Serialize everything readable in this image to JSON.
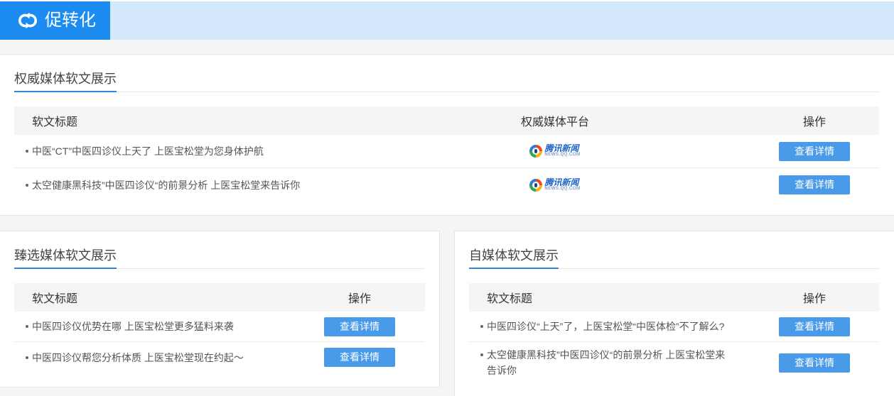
{
  "header": {
    "title": "促转化",
    "logo_icon": "cycle-arrows-icon"
  },
  "colors": {
    "brand_blue": "#1c8cf0",
    "header_bar": "#d4e8fc",
    "button_blue": "#4a9aea",
    "title_underline": "#2b87dc"
  },
  "authority_media": {
    "title": "权威媒体软文展示",
    "columns": {
      "title": "软文标题",
      "platform": "权威媒体平台",
      "action": "操作"
    },
    "rows": [
      {
        "title": "中医“CT”中医四诊仪上天了 上医宝松堂为您身体护航",
        "platform_icon": "tencent-news-icon",
        "platform_name": "腾讯新闻",
        "platform_domain": "NEWS.QQ.COM",
        "action": "查看详情"
      },
      {
        "title": "太空健康黑科技”中医四诊仪“的前景分析 上医宝松堂来告诉你",
        "platform_icon": "tencent-news-icon",
        "platform_name": "腾讯新闻",
        "platform_domain": "NEWS.QQ.COM",
        "action": "查看详情"
      }
    ]
  },
  "selected_media": {
    "title": "臻选媒体软文展示",
    "columns": {
      "title": "软文标题",
      "action": "操作"
    },
    "rows": [
      {
        "title": "中医四诊仪优势在哪 上医宝松堂更多猛料来袭",
        "action": "查看详情"
      },
      {
        "title": "中医四诊仪帮您分析体质 上医宝松堂现在约起～",
        "action": "查看详情"
      }
    ]
  },
  "self_media": {
    "title": "自媒体软文展示",
    "columns": {
      "title": "软文标题",
      "action": "操作"
    },
    "rows": [
      {
        "title": "中医四诊仪“上天”了，上医宝松堂“中医体检”不了解么?",
        "action": "查看详情"
      },
      {
        "title": "太空健康黑科技”中医四诊仪“的前景分析 上医宝松堂来告诉你",
        "action": "查看详情"
      }
    ]
  }
}
